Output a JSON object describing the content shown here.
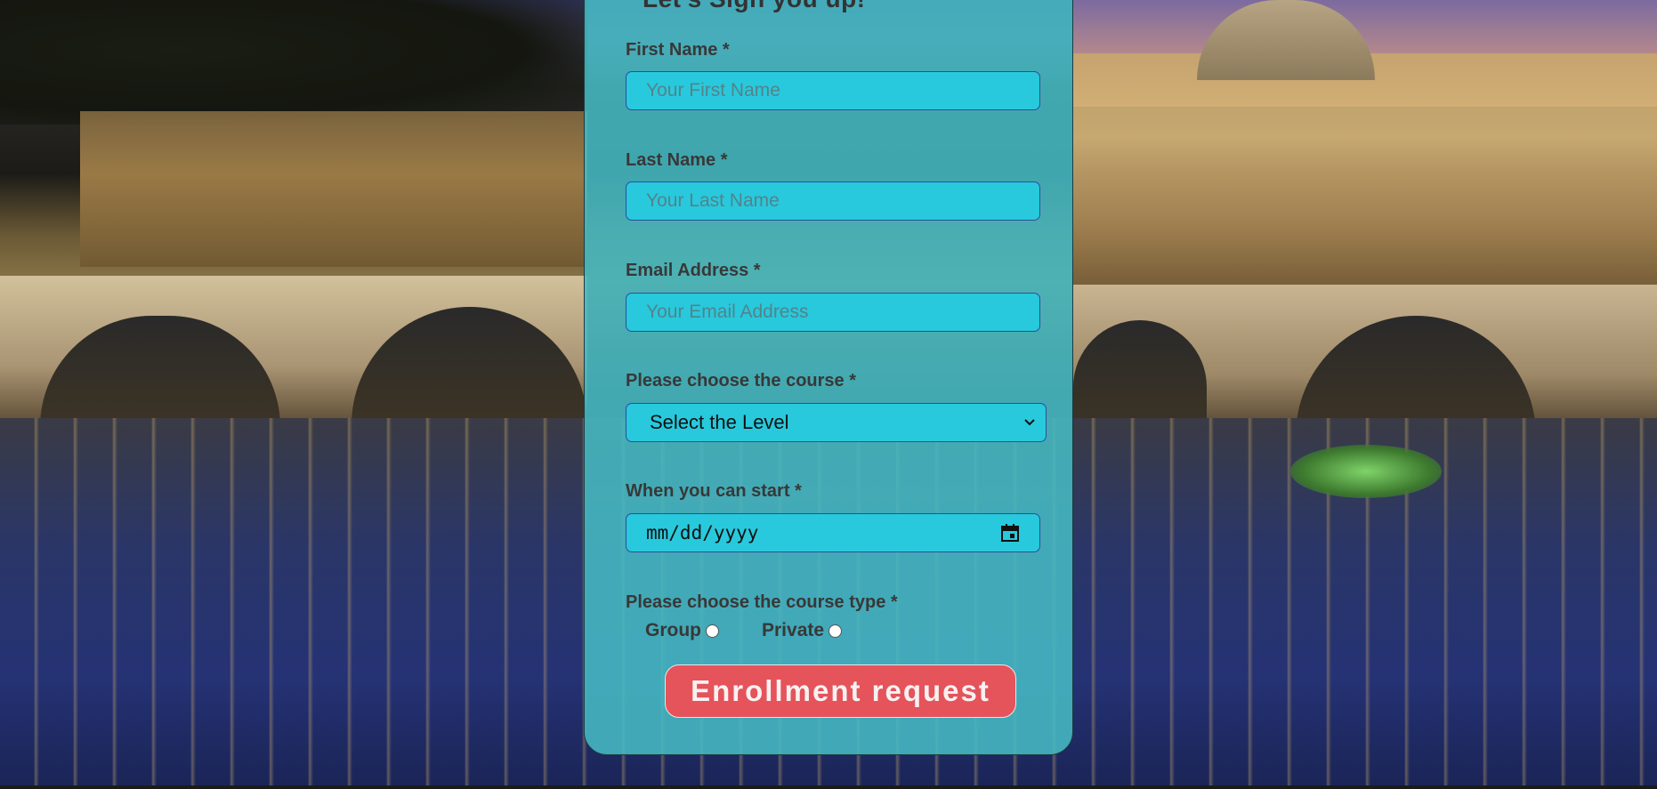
{
  "form": {
    "title": "Let's Sign you up!",
    "first_name": {
      "label": "First Name *",
      "placeholder": "Your First Name",
      "value": ""
    },
    "last_name": {
      "label": "Last Name *",
      "placeholder": "Your Last Name",
      "value": ""
    },
    "email": {
      "label": "Email Address *",
      "placeholder": "Your Email Address",
      "value": ""
    },
    "course": {
      "label": "Please choose the course *",
      "selected": "Select the Level"
    },
    "start_date": {
      "label": "When you can start *",
      "value": "mm/dd/yyyy"
    },
    "course_type": {
      "label": "Please choose the course type *",
      "options": [
        "Group",
        "Private"
      ]
    },
    "submit_label": "Enrollment request"
  },
  "colors": {
    "card_background": "#46b9c3",
    "input_background": "#28c9dc",
    "input_border": "#2a4f9e",
    "button_background": "#e5535b",
    "label_text": "#383838"
  },
  "icons": {
    "select": "chevron-down-icon",
    "date": "calendar-icon"
  }
}
